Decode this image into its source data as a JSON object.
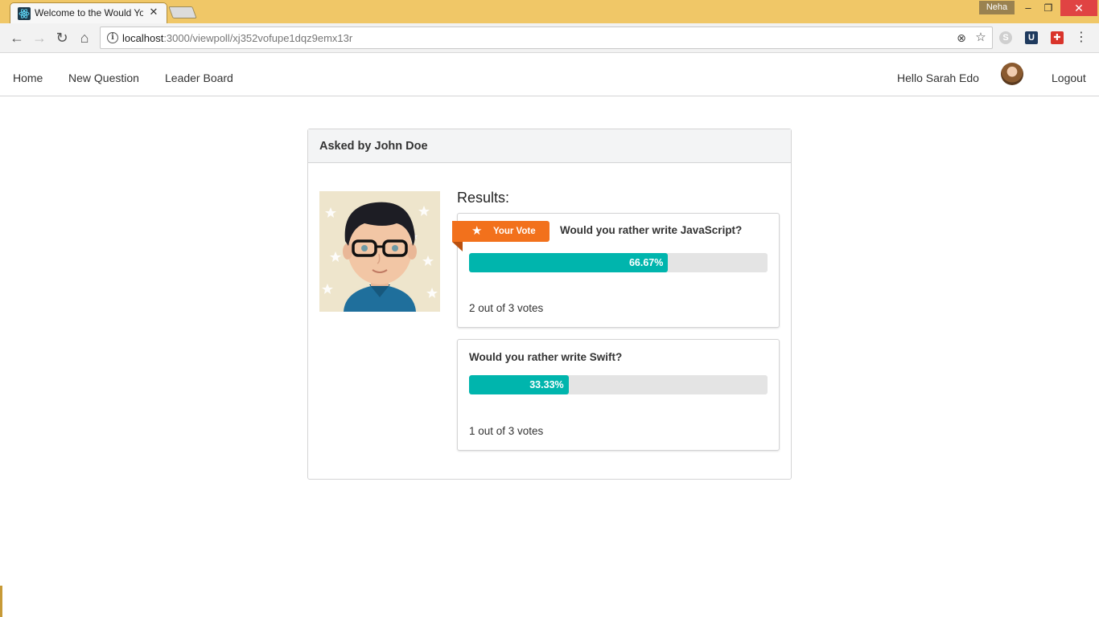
{
  "browser": {
    "tab_title": "Welcome to the Would You Rather App",
    "tab_close_icon": "close-icon",
    "profile_name": "Neha",
    "url_host": "localhost",
    "url_path": ":3000/viewpoll/xj352vofupe1dqz9emx13r",
    "window_controls": {
      "minimize": "–",
      "maximize": "❐",
      "close": "✕"
    },
    "nav_icons": {
      "back": "←",
      "forward": "→",
      "reload": "↻",
      "home": "⌂"
    },
    "omnibox_icons": {
      "info": "i",
      "translate": "⊗",
      "bookmark": "☆"
    },
    "extensions": {
      "skype": "S",
      "upwork": "U",
      "gift": "✚"
    },
    "menu": "⋮"
  },
  "appnav": {
    "home": "Home",
    "new_question": "New Question",
    "leader_board": "Leader Board",
    "greeting": "Hello Sarah Edo",
    "logout": "Logout"
  },
  "poll": {
    "header": "Asked by John Doe",
    "results_title": "Results:",
    "your_vote_label": "Your Vote",
    "options": [
      {
        "text": "Would you rather write JavaScript?",
        "percent_label": "66.67%",
        "percent": 66.67,
        "votes_label": "2 out of 3 votes",
        "is_user_vote": true
      },
      {
        "text": "Would you rather write Swift?",
        "percent_label": "33.33%",
        "percent": 33.33,
        "votes_label": "1 out of 3 votes",
        "is_user_vote": false
      }
    ]
  },
  "colors": {
    "titlebar": "#f0c767",
    "accent_teal": "#00b5ad",
    "ribbon_orange": "#f2711c",
    "close_red": "#e04343"
  }
}
